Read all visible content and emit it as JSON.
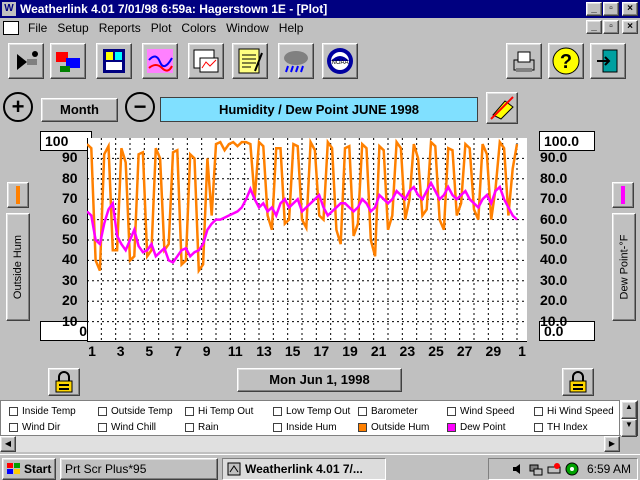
{
  "window": {
    "title": "Weatherlink 4.01    7/01/98    6:59a: Hagerstown 1E - [Plot]",
    "app_title_buttons": [
      "_",
      "▫",
      "×"
    ],
    "doc_title_buttons": [
      "_",
      "▫",
      "×"
    ]
  },
  "menu": [
    "File",
    "Setup",
    "Reports",
    "Plot",
    "Colors",
    "Window",
    "Help"
  ],
  "toolbar": {
    "tools": [
      "select-station-icon",
      "download-icon",
      "bulletin-icon",
      "browse-icon",
      "plot-icon",
      "summary-icon",
      "forecast-icon",
      "noaa-icon",
      "print-icon",
      "help-icon",
      "exit-icon"
    ]
  },
  "controls": {
    "zoom_in": "+",
    "period": "Month",
    "zoom_out": "−",
    "plot_title": "Humidity / Dew Point  JUNE  1998"
  },
  "left_axis": {
    "top_value": "100",
    "bottom_value": "0",
    "ticks": [
      "90",
      "80",
      "70",
      "60",
      "50",
      "40",
      "30",
      "20",
      "10"
    ],
    "label": "Outside Hum"
  },
  "right_axis": {
    "top_value": "100.0",
    "bottom_value": "0.0",
    "ticks": [
      "90.0",
      "80.0",
      "70.0",
      "60.0",
      "50.0",
      "40.0",
      "30.0",
      "20.0",
      "10.0"
    ],
    "label": "Dew Point-°F"
  },
  "x_axis": {
    "ticks": [
      "1",
      "3",
      "5",
      "7",
      "9",
      "11",
      "13",
      "15",
      "17",
      "19",
      "21",
      "23",
      "25",
      "27",
      "29",
      "1"
    ]
  },
  "date_display": "Mon Jun 1, 1998",
  "colors": {
    "outside_hum": "#ff8000",
    "dew_point": "#ff00ff",
    "title_bg": "#80e0ff",
    "titlebar": "#000080"
  },
  "legend": [
    {
      "label": "Inside Temp",
      "checked": false,
      "color": "#ffffff"
    },
    {
      "label": "Outside Temp",
      "checked": false,
      "color": "#ffffff"
    },
    {
      "label": "Hi Temp Out",
      "checked": false,
      "color": "#ffffff"
    },
    {
      "label": "Low Temp Out",
      "checked": false,
      "color": "#ffffff"
    },
    {
      "label": "Barometer",
      "checked": false,
      "color": "#ffffff"
    },
    {
      "label": "Wind Speed",
      "checked": false,
      "color": "#ffffff"
    },
    {
      "label": "Hi Wind Speed",
      "checked": false,
      "color": "#ffffff"
    },
    {
      "label": "Wind Dir",
      "checked": false,
      "color": "#ffffff"
    },
    {
      "label": "Wind Chill",
      "checked": false,
      "color": "#ffffff"
    },
    {
      "label": "Rain",
      "checked": false,
      "color": "#ffffff"
    },
    {
      "label": "Inside Hum",
      "checked": false,
      "color": "#ffffff"
    },
    {
      "label": "Outside Hum",
      "checked": true,
      "color": "#ff8000"
    },
    {
      "label": "Dew Point",
      "checked": true,
      "color": "#ff00ff"
    },
    {
      "label": "TH Index",
      "checked": false,
      "color": "#ffffff"
    }
  ],
  "taskbar": {
    "start": "Start",
    "tasks": [
      "Prt Scr Plus*95",
      "Weatherlink 4.01    7/..."
    ],
    "clock": "6:59 AM"
  },
  "chart_data": {
    "type": "line",
    "xlabel": "",
    "ylabel": "Outside Hum",
    "y2label": "Dew Point-°F",
    "xlim": [
      1,
      31
    ],
    "ylim": [
      0,
      100
    ],
    "grid": true,
    "series": [
      {
        "name": "Outside Hum",
        "x": [
          1,
          1.3,
          1.6,
          1.9,
          2.2,
          2.5,
          2.8,
          3.1,
          3.4,
          3.7,
          4.0,
          4.3,
          4.6,
          4.9,
          5.2,
          5.5,
          5.8,
          6.1,
          6.4,
          6.7,
          7.0,
          7.3,
          7.6,
          7.9,
          8.2,
          8.5,
          8.8,
          9.1,
          9.4,
          9.7,
          10.0,
          10.3,
          10.6,
          10.9,
          11.2,
          11.5,
          11.8,
          12.1,
          12.4,
          12.7,
          13.0,
          13.3,
          13.6,
          13.9,
          14.2,
          14.5,
          14.8,
          15.1,
          15.4,
          15.7,
          16.0,
          16.3,
          16.6,
          16.9,
          17.2,
          17.5,
          17.8,
          18.1,
          18.4,
          18.7,
          19.0,
          19.3,
          19.6,
          19.9,
          20.2,
          20.5,
          20.8,
          21.1,
          21.4,
          21.7,
          22.0,
          22.3,
          22.6,
          22.9,
          23.2,
          23.5,
          23.8,
          24.1,
          24.4,
          24.7,
          25.0,
          25.3,
          25.6,
          25.9,
          26.2,
          26.5,
          26.8,
          27.1,
          27.4,
          27.7,
          28.0,
          28.3,
          28.6,
          28.9,
          29.2,
          29.5,
          29.8,
          30.1,
          30.4,
          30.7,
          31.0
        ],
        "values": [
          97,
          95,
          40,
          35,
          92,
          96,
          45,
          45,
          95,
          88,
          40,
          42,
          92,
          93,
          42,
          45,
          95,
          90,
          45,
          48,
          93,
          94,
          38,
          40,
          92,
          90,
          35,
          38,
          90,
          62,
          97,
          98,
          94,
          97,
          98,
          96,
          98,
          98,
          97,
          70,
          98,
          96,
          62,
          55,
          95,
          95,
          58,
          60,
          97,
          96,
          60,
          56,
          98,
          94,
          62,
          60,
          98,
          95,
          55,
          48,
          95,
          96,
          52,
          58,
          97,
          95,
          50,
          42,
          96,
          94,
          55,
          62,
          98,
          95,
          60,
          70,
          97,
          90,
          62,
          65,
          98,
          96,
          60,
          55,
          95,
          94,
          62,
          68,
          97,
          95,
          65,
          60,
          97,
          92,
          60,
          75,
          98,
          95,
          62,
          85,
          97
        ]
      },
      {
        "name": "Dew Point",
        "x": [
          1,
          1.3,
          1.6,
          1.9,
          2.2,
          2.5,
          2.8,
          3.1,
          3.4,
          3.7,
          4.0,
          4.3,
          4.6,
          4.9,
          5.2,
          5.5,
          5.8,
          6.1,
          6.4,
          6.7,
          7.0,
          7.3,
          7.6,
          7.9,
          8.2,
          8.5,
          8.8,
          9.1,
          9.4,
          9.7,
          10.0,
          10.3,
          10.6,
          10.9,
          11.2,
          11.5,
          11.8,
          12.1,
          12.4,
          12.7,
          13.0,
          13.3,
          13.6,
          13.9,
          14.2,
          14.5,
          14.8,
          15.1,
          15.4,
          15.7,
          16.0,
          16.3,
          16.6,
          16.9,
          17.2,
          17.5,
          17.8,
          18.1,
          18.4,
          18.7,
          19.0,
          19.3,
          19.6,
          19.9,
          20.2,
          20.5,
          20.8,
          21.1,
          21.4,
          21.7,
          22.0,
          22.3,
          22.6,
          22.9,
          23.2,
          23.5,
          23.8,
          24.1,
          24.4,
          24.7,
          25.0,
          25.3,
          25.6,
          25.9,
          26.2,
          26.5,
          26.8,
          27.1,
          27.4,
          27.7,
          28.0,
          28.3,
          28.6,
          28.9,
          29.2,
          29.5,
          29.8,
          30.1,
          30.4,
          30.7,
          31.0
        ],
        "values": [
          64,
          62,
          50,
          48,
          58,
          65,
          68,
          52,
          48,
          45,
          50,
          55,
          47,
          44,
          45,
          48,
          42,
          44,
          46,
          40,
          39,
          42,
          45,
          46,
          42,
          44,
          45,
          48,
          55,
          58,
          60,
          60,
          61,
          62,
          63,
          64,
          66,
          70,
          75,
          70,
          66,
          68,
          64,
          66,
          62,
          68,
          70,
          66,
          68,
          70,
          64,
          66,
          68,
          70,
          72,
          66,
          62,
          64,
          66,
          68,
          68,
          66,
          64,
          66,
          70,
          68,
          64,
          66,
          72,
          70,
          68,
          70,
          74,
          72,
          70,
          74,
          76,
          72,
          70,
          74,
          78,
          74,
          70,
          72,
          76,
          72,
          70,
          72,
          74,
          70,
          68,
          66,
          70,
          72,
          68,
          74,
          76,
          70,
          66,
          62,
          60
        ]
      }
    ]
  }
}
